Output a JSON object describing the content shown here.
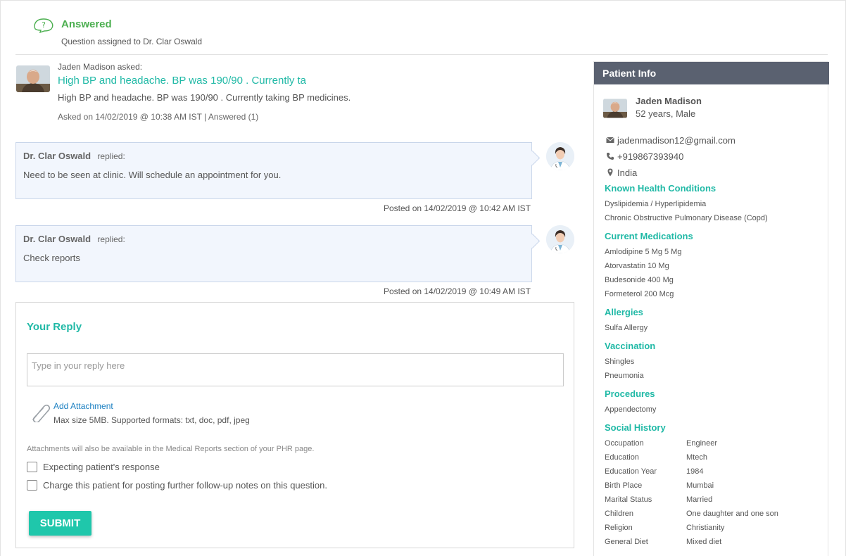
{
  "status": {
    "label": "Answered",
    "assigned_text": "Question assigned to Dr. Clar Oswald"
  },
  "question": {
    "asker_line": "Jaden Madison asked:",
    "title": "High BP and headache. BP was 190/90 . Currently ta",
    "body": "High BP and headache. BP was 190/90 . Currently taking BP medicines.",
    "meta": "Asked on 14/02/2019 @ 10:38 AM IST | Answered (1)"
  },
  "replies": [
    {
      "doctor": "Dr. Clar Oswald",
      "action": "replied:",
      "text": "Need to be seen at clinic. Will schedule an appointment for you.",
      "posted": "Posted on 14/02/2019 @ 10:42 AM IST"
    },
    {
      "doctor": "Dr. Clar Oswald",
      "action": "replied:",
      "text": "Check reports",
      "posted": "Posted on 14/02/2019 @ 10:49 AM IST"
    }
  ],
  "reply_form": {
    "title": "Your Reply",
    "placeholder": "Type in your reply here",
    "add_attachment": "Add Attachment",
    "attachment_hint": "Max size 5MB. Supported formats: txt, doc, pdf, jpeg",
    "attachment_note": "Attachments will also be available in the Medical Reports section of your PHR page.",
    "checkbox_expecting": "Expecting patient's response",
    "checkbox_charge": "Charge this patient for posting further follow-up notes on this question.",
    "submit_label": "SUBMIT"
  },
  "patient": {
    "header": "Patient Info",
    "name": "Jaden Madison",
    "age_gender": "52 years, Male",
    "email": "jadenmadison12@gmail.com",
    "phone": "+919867393940",
    "location": "India",
    "sections": {
      "conditions_title": "Known Health Conditions",
      "conditions": [
        "Dyslipidemia / Hyperlipidemia",
        "Chronic Obstructive Pulmonary Disease (Copd)"
      ],
      "medications_title": "Current Medications",
      "medications": [
        "Amlodipine 5 Mg 5 Mg",
        "Atorvastatin 10 Mg",
        "Budesonide 400 Mg",
        "Formeterol 200 Mcg"
      ],
      "allergies_title": "Allergies",
      "allergies": [
        "Sulfa Allergy"
      ],
      "vaccination_title": "Vaccination",
      "vaccination": [
        "Shingles",
        "Pneumonia"
      ],
      "procedures_title": "Procedures",
      "procedures": [
        "Appendectomy"
      ],
      "social_title": "Social History",
      "social": [
        {
          "key": "Occupation",
          "value": "Engineer"
        },
        {
          "key": "Education",
          "value": "Mtech"
        },
        {
          "key": "Education Year",
          "value": "1984"
        },
        {
          "key": "Birth Place",
          "value": "Mumbai"
        },
        {
          "key": "Marital Status",
          "value": "Married"
        },
        {
          "key": "Children",
          "value": "One daughter and one son"
        },
        {
          "key": "Religion",
          "value": "Christianity"
        },
        {
          "key": "General Diet",
          "value": "Mixed diet"
        }
      ]
    }
  },
  "colors": {
    "accent": "#20b9a6",
    "status_green": "#4caf50",
    "submit": "#1fc7ab",
    "panel_header": "#5a6170",
    "reply_bg": "#f2f6fd"
  }
}
